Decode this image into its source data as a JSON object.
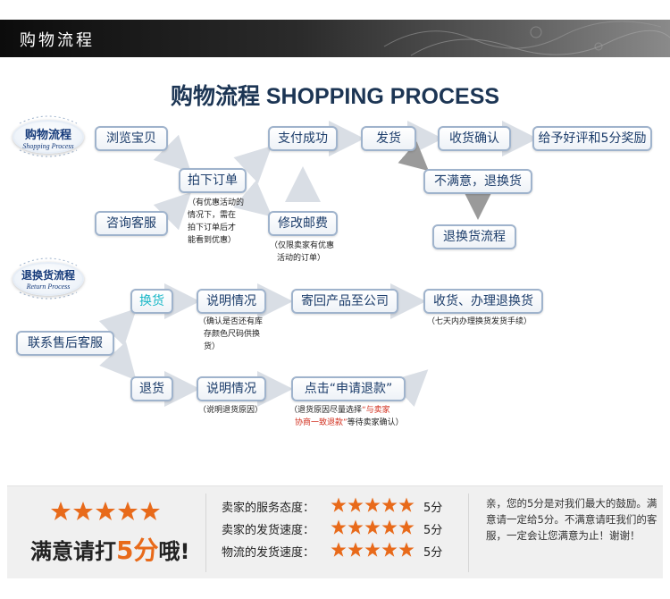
{
  "header": {
    "title": "购物流程"
  },
  "main_title": "购物流程 SHOPPING PROCESS",
  "badges": {
    "shopping": {
      "cn": "购物流程",
      "en": "Shopping Process"
    },
    "returns": {
      "cn": "退换货流程",
      "en": "Return Process"
    }
  },
  "shopping_flow": {
    "browse": "浏览宝贝",
    "consult": "咨询客服",
    "place_order": "拍下订单",
    "pay_success": "支付成功",
    "ship": "发货",
    "confirm_receipt": "收货确认",
    "good_review": "给予好评和5分奖励",
    "not_satisfied": "不满意，退换货",
    "return_flow": "退换货流程",
    "change_postage": "修改邮费",
    "note_order": [
      "（有优惠活动的",
      "情况下，需在",
      "拍下订单后才",
      "能看到优惠）"
    ],
    "note_postage": [
      "（仅限卖家有优惠",
      "活动的订单）"
    ]
  },
  "return_flow": {
    "contact_service": "联系售后客服",
    "exchange": "换货",
    "refund": "退货",
    "explain_exchange": "说明情况",
    "send_back": "寄回产品至公司",
    "receive_exchange": "收货、办理退换货",
    "explain_refund": "说明情况",
    "click_refund": "点击“申请退款”",
    "note_exchange": [
      "（确认是否还有库",
      "存颜色尺码供换",
      "货）"
    ],
    "note_seven_days": "（七天内办理换货发货手续）",
    "note_refund_reason": "（说明退货原因）",
    "note_refund_a": "（退货原因尽量选择",
    "note_refund_red_a": "“与卖家",
    "note_refund_red_b": "协商一致退款”",
    "note_refund_b": "等待卖家确认）"
  },
  "rating": {
    "slogan_a": "满意请打",
    "slogan_num": "5分",
    "slogan_b": "哦!",
    "rows": [
      {
        "label": "卖家的服务态度：",
        "score": "5分",
        "stars": 5
      },
      {
        "label": "卖家的发货速度：",
        "score": "5分",
        "stars": 5
      },
      {
        "label": "物流的发货速度：",
        "score": "5分",
        "stars": 5
      }
    ],
    "message": "亲，您的5分是对我们最大的鼓励。满意请一定给5分。不满意请旺我们的客服，一定会让您满意为止！谢谢！"
  },
  "colors": {
    "accent_orange": "#e86a1a",
    "box_border": "#9fb3cc",
    "box_text": "#1b3c6a",
    "cyan_text": "#19b7c7",
    "note_red": "#d2301f"
  }
}
